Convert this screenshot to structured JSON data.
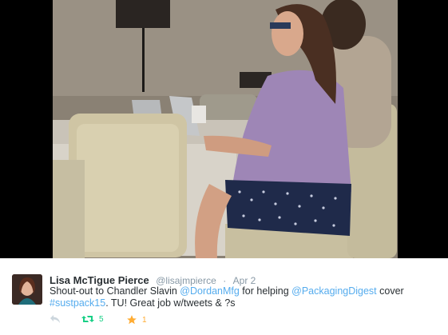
{
  "tweet": {
    "author_name": "Lisa McTigue Pierce",
    "handle": "@lisajmpierce",
    "separator": "·",
    "date": "Apr 2",
    "text_parts": {
      "t1": "Shout-out to Chandler Slavin ",
      "m1": "@DordanMfg",
      "t2": " for helping ",
      "m2": "@PackagingDigest",
      "t3": " cover ",
      "h1": "#sustpack15",
      "t4": ". TU! Great job w/tweets & ?s"
    },
    "actions": {
      "reply_icon": "reply-icon",
      "retweet_icon": "retweet-icon",
      "retweet_count": "5",
      "favorite_icon": "star-icon",
      "favorite_count": "1"
    }
  },
  "colors": {
    "link": "#55acee",
    "retweet": "#19cf86",
    "favorite": "#ffac33",
    "muted": "#8899a6",
    "text": "#292f33"
  }
}
